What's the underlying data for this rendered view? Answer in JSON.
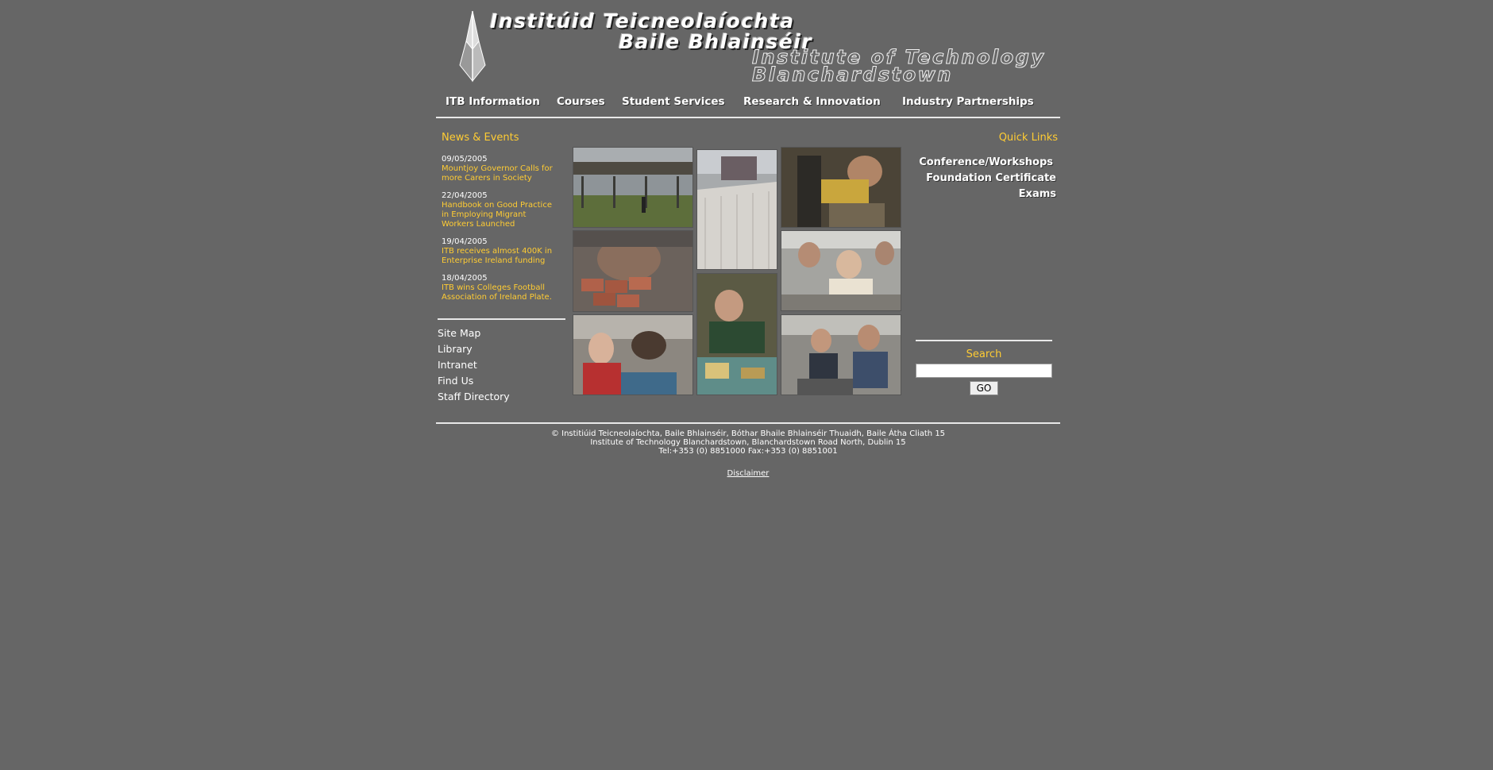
{
  "header": {
    "title_ga_line1": "Institúid Teicneolaíochta",
    "title_ga_line2": "Baile Bhlainséir",
    "title_en_line1": "Institute of Technology",
    "title_en_line2": "Blanchardstown",
    "logo_icon": "itb-crest-icon"
  },
  "nav": {
    "items": [
      {
        "label": "ITB Information"
      },
      {
        "label": "Courses"
      },
      {
        "label": "Student Services"
      },
      {
        "label": "Research & Innovation"
      },
      {
        "label": "Industry Partnerships"
      }
    ]
  },
  "news": {
    "heading": "News & Events",
    "items": [
      {
        "date": "09/05/2005",
        "title": "Mountjoy Governor Calls for more Carers in Society"
      },
      {
        "date": "22/04/2005",
        "title": "Handbook on Good Practice in Employing Migrant Workers Launched"
      },
      {
        "date": "19/04/2005",
        "title": "ITB receives almost 400K in Enterprise Ireland funding"
      },
      {
        "date": "18/04/2005",
        "title": "ITB wins Colleges Football Association of Ireland Plate."
      }
    ]
  },
  "side_links": [
    {
      "label": "Site Map"
    },
    {
      "label": "Library"
    },
    {
      "label": "Intranet"
    },
    {
      "label": "Find Us"
    },
    {
      "label": "Staff Directory"
    }
  ],
  "quick_links": {
    "heading": "Quick Links",
    "items": [
      {
        "label": "Conference/Workshops"
      },
      {
        "label": "Foundation Certificate"
      },
      {
        "label": "Exams"
      }
    ]
  },
  "search": {
    "heading": "Search",
    "value": "",
    "button_label": "GO"
  },
  "footer": {
    "line1": "© Institiúid Teicneolaíochta, Baile Bhlainséir, Bóthar Bhaile Bhlainséir Thuaidh, Baile Átha Cliath 15",
    "line2": "Institute of Technology Blanchardstown, Blanchardstown Road North, Dublin 15",
    "line3": "Tel:+353 (0) 8851000 Fax:+353 (0) 8851001",
    "disclaimer": "Disclaimer"
  },
  "colors": {
    "background": "#666666",
    "accent": "#ffcc33",
    "text": "#ffffff"
  }
}
